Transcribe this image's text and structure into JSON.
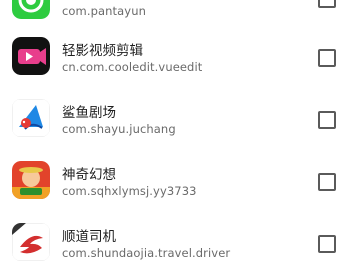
{
  "apps": [
    {
      "name": "",
      "package": "com.pantayun",
      "icon": "green-phone-app-icon",
      "checked": false
    },
    {
      "name": "轻影视频剪辑",
      "package": "cn.com.cooledit.vueedit",
      "icon": "video-editor-icon",
      "checked": false
    },
    {
      "name": "鲨鱼剧场",
      "package": "com.shayu.juchang",
      "icon": "shark-theater-icon",
      "checked": false
    },
    {
      "name": "神奇幻想",
      "package": "com.sqhxlymsj.yy3733",
      "icon": "anime-game-icon",
      "checked": false
    },
    {
      "name": "顺道司机",
      "package": "com.shundaojia.travel.driver",
      "icon": "driver-app-icon",
      "checked": false
    }
  ],
  "colors": {
    "accent_green": "#2ecc40",
    "text_primary": "#1f1f1f",
    "text_secondary": "#6a6a6a"
  }
}
